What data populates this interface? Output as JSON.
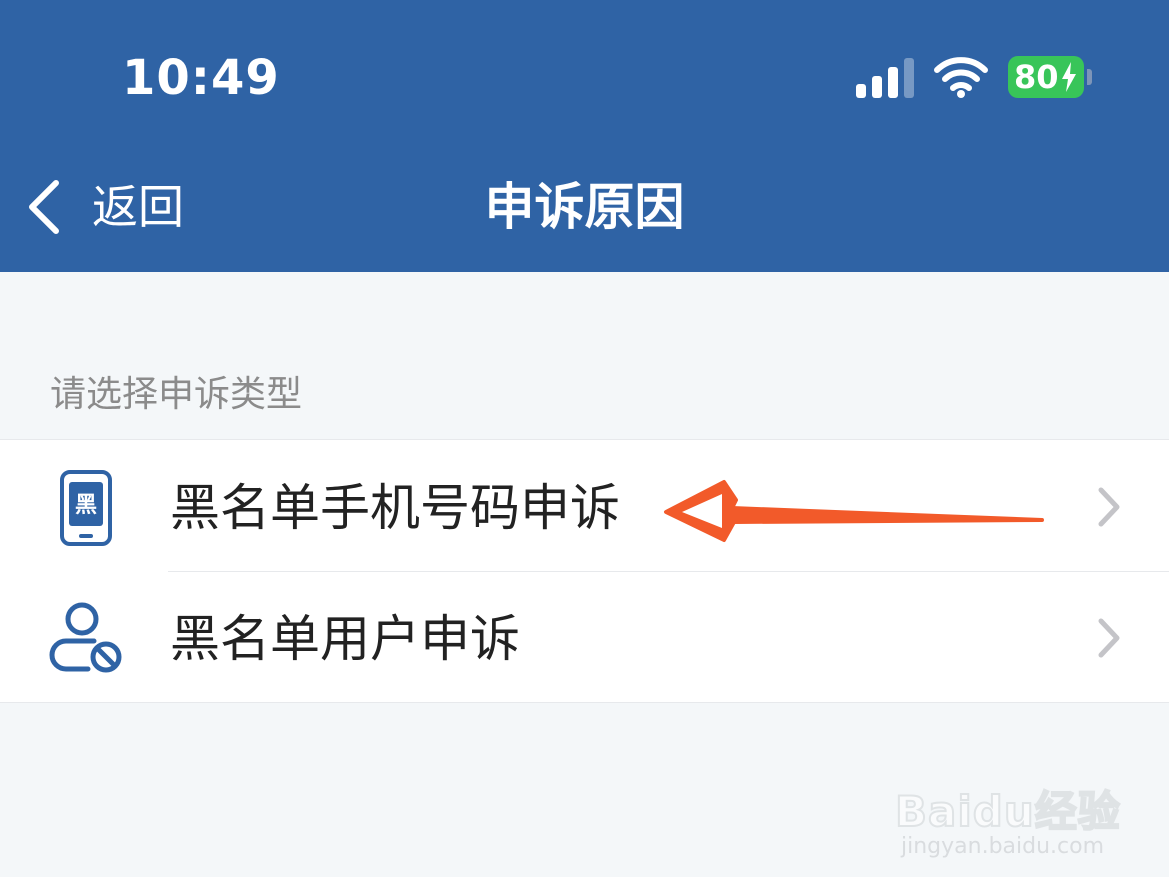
{
  "status_bar": {
    "time": "10:49",
    "battery_level": "80",
    "signal_icon": "cellular-signal-icon",
    "wifi_icon": "wifi-icon"
  },
  "nav": {
    "back_label": "返回",
    "title": "申诉原因"
  },
  "section_label": "请选择申诉类型",
  "items": [
    {
      "label": "黑名单手机号码申诉",
      "icon": "blacklist-phone-icon"
    },
    {
      "label": "黑名单用户申诉",
      "icon": "blocked-user-icon"
    }
  ],
  "watermark": {
    "brand": "Baidu经验",
    "url": "jingyan.baidu.com"
  },
  "colors": {
    "header_bg": "#2f63a5",
    "background": "#f4f7f9",
    "icon_blue": "#2f63a5",
    "arrow": "#f25a2a",
    "battery": "#38c559"
  }
}
